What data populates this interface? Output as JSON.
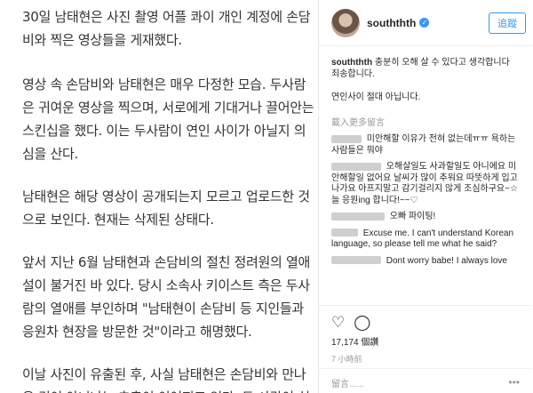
{
  "article": {
    "paragraphs": [
      "30일 남태현은 사진 촬영 어플 콰이 개인 계정에 손담비와 찍은 영상들을 게재했다.",
      "영상 속 손담비와 남태현은 매우 다정한 모습. 두사람은 귀여운 영상을 찍으며, 서로에게 기대거나 끌어안는 스킨십을 했다. 이는 두사람이 연인 사이가 아닐지 의심을 산다.",
      "남태현은 해당 영상이 공개되는지 모르고 업로드한 것으로 보인다. 현재는 삭제된 상태다.",
      "앞서 지난 6월 남태현과 손담비의 절친 정려원의 열애설이 불거진 바 있다. 당시 소속사 키이스트 측은 두사람의 열애를 부인하며 \"남태현이 손담비 등 지인들과 응원차 현장을 방문한 것\"이라고 해명했다.",
      "이날 사진이 유출된 후, 사실 남태현은 손담비와 만나온 것이 아니냐는 추측이 이어지고 있다. 두 사람이 실"
    ]
  },
  "instagram": {
    "username": "souththth",
    "verified_mark": "✓",
    "follow_label": "追蹤",
    "caption_user": "souththth",
    "caption_text": " 충분히 오해 살 수 있다고 생각합니다",
    "caption_line2": "죄송합니다.",
    "caption_line3": "연인사이 절대 아닙니다.",
    "load_more": "載入更多留言",
    "comments": [
      {
        "text": " 미안해할 이유가 전혀 없는데ㅠㅠ 욕하는 사람들은 뭐야"
      },
      {
        "text": " 오해살일도 사과할일도 아니에요 미안해할일 없어요 날씨가 많이 추워요 따뜻하게 입고 나가요 아프지말고 감기걸리지 않게 조심하구요~☆ 늘 응원ing 합니다!~~♡"
      },
      {
        "text": " 오빠 파이팅!"
      },
      {
        "text": " Excuse me. I can't understand Korean language, so please tell me what he said?"
      },
      {
        "text": " Dont worry babe! I always love"
      }
    ],
    "icons": {
      "like": "heart-icon",
      "comment": "comment-icon"
    },
    "likes": "17,174 個讚",
    "time": "7 小時前",
    "comment_placeholder": "留言......",
    "more_options": "•••"
  }
}
